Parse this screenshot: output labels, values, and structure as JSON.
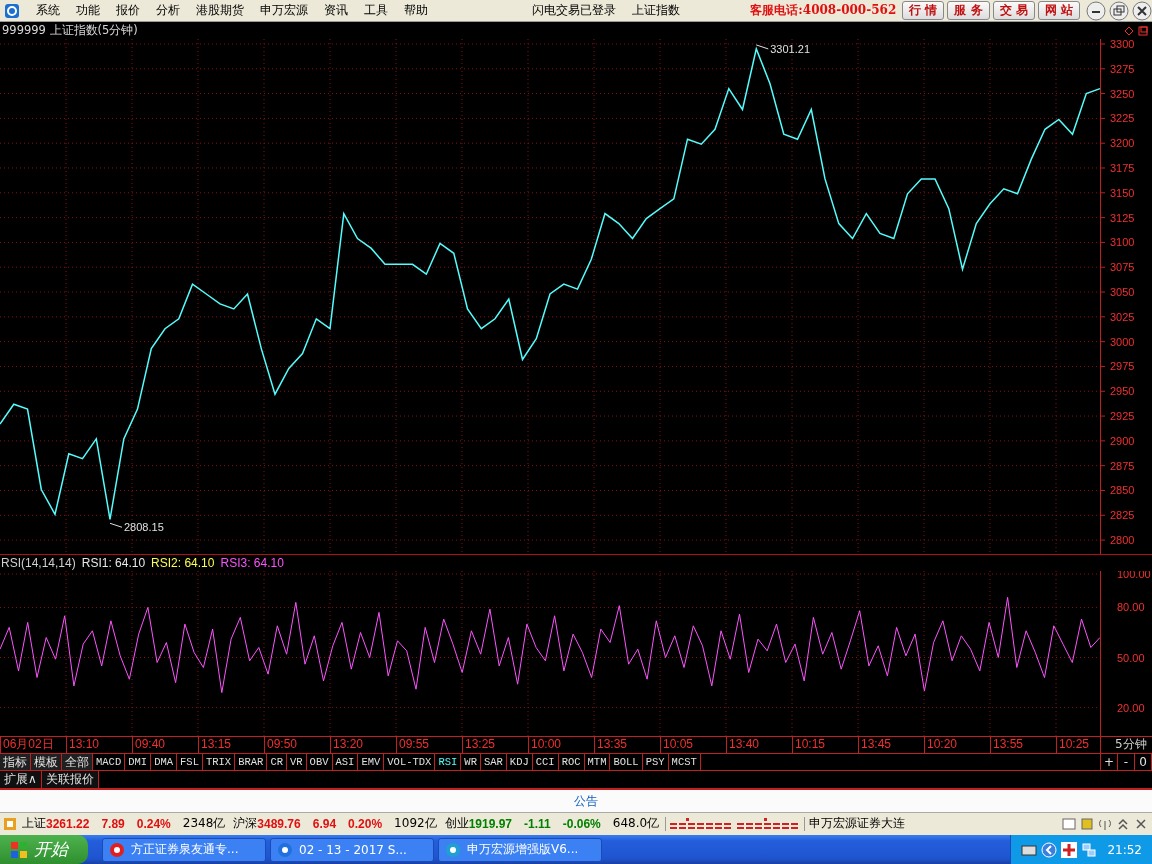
{
  "menu_bar": {
    "items": [
      "系统",
      "功能",
      "报价",
      "分析",
      "港股期货",
      "申万宏源",
      "资讯",
      "工具",
      "帮助"
    ],
    "status_texts": [
      "闪电交易已登录",
      "上证指数"
    ],
    "hotline": "客服电话:4008-000-562",
    "buttons": [
      "行 情",
      "服 务",
      "交 易",
      "网 站"
    ]
  },
  "main_chart": {
    "chart_data": {
      "type": "line",
      "title": "999999 上证指数(5分钟)",
      "ylim": [
        2786,
        3305
      ],
      "grid": true,
      "categories": [
        null,
        null,
        null,
        null,
        null,
        null,
        null,
        null,
        null,
        null,
        null,
        null,
        null,
        null,
        null,
        null,
        null,
        null,
        null,
        null,
        null,
        null,
        null,
        null,
        null,
        null,
        null,
        null,
        null,
        null,
        null,
        null,
        null,
        null,
        null,
        null,
        null,
        null,
        null,
        null,
        null,
        null,
        null,
        null,
        null,
        null,
        null,
        null,
        null,
        null,
        null,
        null,
        null,
        null,
        null,
        null,
        null,
        null,
        null,
        null,
        null,
        null,
        null,
        null,
        null,
        null,
        null,
        null,
        null,
        null,
        null,
        null,
        null,
        null,
        null,
        null,
        null,
        null,
        null,
        null,
        null
      ],
      "yticks": [
        2800,
        2825,
        2850,
        2875,
        2900,
        2925,
        2950,
        2975,
        3000,
        3025,
        3050,
        3075,
        3100,
        3125,
        3150,
        3175,
        3200,
        3225,
        3250,
        3275,
        3300
      ],
      "series": [
        {
          "color": "#54fcfc",
          "values": [
            2917,
            2937,
            2932,
            2851,
            2826,
            2887,
            2882,
            2902,
            2821,
            2902,
            2932,
            2993,
            3013,
            3023,
            3058,
            3048,
            3038,
            3033,
            3048,
            2993,
            2947,
            2973,
            2988,
            3023,
            3013,
            3129,
            3104,
            3094,
            3078,
            3078,
            3078,
            3068,
            3099,
            3089,
            3033,
            3013,
            3023,
            3043,
            2982,
            3003,
            3048,
            3058,
            3053,
            3083,
            3129,
            3119,
            3104,
            3124,
            3134,
            3144,
            3204,
            3199,
            3214,
            3255,
            3234,
            3295,
            3260,
            3209,
            3204,
            3234,
            3164,
            3119,
            3104,
            3129,
            3109,
            3104,
            3149,
            3164,
            3164,
            3134,
            3073,
            3119,
            3139,
            3154,
            3149,
            3184,
            3214,
            3224,
            3209,
            3250,
            3255
          ]
        }
      ],
      "annotations": [
        "3301.21",
        "2808.15"
      ]
    }
  },
  "indicator": {
    "name": "RSI(14,14,14)",
    "lines": [
      {
        "label": "RSI1: 64.10",
        "color": "#e8e8e8"
      },
      {
        "label": "RSI2: 64.10",
        "color": "#fcfc54"
      },
      {
        "label": "RSI3: 64.10",
        "color": "#fc54fc"
      }
    ],
    "chart_data": {
      "type": "line",
      "ylim": [
        3,
        101.8
      ],
      "grid": true,
      "yticks": [
        {
          "value": 100,
          "label": "100.00"
        },
        {
          "value": 80,
          "label": "80.00"
        },
        {
          "value": 50,
          "label": "50.00"
        },
        {
          "value": 20,
          "label": "20.00"
        }
      ],
      "categories": [
        null,
        null,
        null,
        null,
        null,
        null,
        null,
        null,
        null,
        null,
        null,
        null,
        null,
        null,
        null,
        null,
        null,
        null,
        null,
        null,
        null,
        null,
        null,
        null,
        null,
        null,
        null,
        null,
        null,
        null,
        null,
        null,
        null,
        null,
        null,
        null,
        null,
        null,
        null,
        null,
        null,
        null,
        null,
        null,
        null,
        null,
        null,
        null,
        null,
        null,
        null,
        null,
        null,
        null,
        null,
        null,
        null,
        null,
        null,
        null,
        null,
        null,
        null,
        null,
        null,
        null,
        null,
        null,
        null,
        null,
        null,
        null,
        null,
        null,
        null,
        null,
        null,
        null,
        null,
        null,
        null,
        null,
        null,
        null,
        null,
        null,
        null,
        null,
        null,
        null,
        null,
        null,
        null,
        null,
        null,
        null,
        null,
        null,
        null,
        null,
        null,
        null,
        null,
        null,
        null,
        null,
        null,
        null,
        null,
        null,
        null,
        null,
        null,
        null,
        null,
        null,
        null,
        null,
        null,
        null
      ],
      "series": [
        {
          "color": "#fc54fc",
          "values": [
            55,
            68,
            42,
            71,
            38,
            62,
            49,
            75,
            33,
            58,
            66,
            45,
            72,
            51,
            37,
            64,
            80,
            47,
            59,
            35,
            70,
            53,
            44,
            67,
            29,
            61,
            74,
            48,
            56,
            40,
            69,
            52,
            83,
            46,
            63,
            36,
            57,
            71,
            43,
            65,
            50,
            77,
            39,
            60,
            54,
            31,
            68,
            47,
            73,
            58,
            41,
            66,
            52,
            79,
            45,
            62,
            34,
            70,
            56,
            48,
            75,
            42,
            64,
            53,
            38,
            67,
            59,
            81,
            46,
            55,
            37,
            72,
            50,
            63,
            44,
            69,
            57,
            33,
            66,
            49,
            76,
            41,
            61,
            54,
            70,
            47,
            58,
            36,
            74,
            52,
            65,
            43,
            60,
            78,
            45,
            57,
            39,
            68,
            51,
            64,
            30,
            59,
            72,
            48,
            63,
            55,
            42,
            71,
            50,
            86,
            44,
            66,
            53,
            38,
            69,
            58,
            47,
            73,
            56,
            62
          ]
        }
      ]
    }
  },
  "time_axis": [
    "06月02日",
    "13:10",
    "09:40",
    "13:15",
    "09:50",
    "13:20",
    "09:55",
    "13:25",
    "10:00",
    "13:35",
    "10:05",
    "13:40",
    "10:15",
    "13:45",
    "10:20",
    "13:55",
    "10:25"
  ],
  "period": "5分钟",
  "indicator_tabs": [
    {
      "label": "指标",
      "selected": false
    },
    {
      "label": "模板",
      "selected": false
    },
    {
      "label": "全部",
      "selected": false
    },
    {
      "label": "MACD",
      "selected": false
    },
    {
      "label": "DMI",
      "selected": false
    },
    {
      "label": "DMA",
      "selected": false
    },
    {
      "label": "FSL",
      "selected": false
    },
    {
      "label": "TRIX",
      "selected": false
    },
    {
      "label": "BRAR",
      "selected": false
    },
    {
      "label": "CR",
      "selected": false
    },
    {
      "label": "VR",
      "selected": false
    },
    {
      "label": "OBV",
      "selected": false
    },
    {
      "label": "ASI",
      "selected": false
    },
    {
      "label": "EMV",
      "selected": false
    },
    {
      "label": "VOL-TDX",
      "selected": false
    },
    {
      "label": "RSI",
      "selected": true
    },
    {
      "label": "WR",
      "selected": false
    },
    {
      "label": "SAR",
      "selected": false
    },
    {
      "label": "KDJ",
      "selected": false
    },
    {
      "label": "CCI",
      "selected": false
    },
    {
      "label": "ROC",
      "selected": false
    },
    {
      "label": "MTM",
      "selected": false
    },
    {
      "label": "BOLL",
      "selected": false
    },
    {
      "label": "PSY",
      "selected": false
    },
    {
      "label": "MCST",
      "selected": false
    }
  ],
  "zoom_buttons": [
    "+",
    "-",
    "0"
  ],
  "extra_tabs": [
    "扩展∧",
    "关联报价"
  ],
  "notice": "公告",
  "status_bar": {
    "quotes": [
      {
        "name": "上证",
        "price": "3261.22",
        "change": "7.89",
        "percent": "0.24%",
        "volume": "2348亿",
        "color": "#e01010"
      },
      {
        "name": "沪深",
        "price": "3489.76",
        "change": "6.94",
        "percent": "0.20%",
        "volume": "1092亿",
        "color": "#e01010"
      },
      {
        "name": "创业",
        "price": "1919.97",
        "change": "-1.11",
        "percent": "-0.06%",
        "volume": "648.0亿",
        "color": "#008000"
      }
    ],
    "broker": "申万宏源证券大连"
  },
  "taskbar": {
    "start": "开始",
    "tasks": [
      "方正证券泉友通专...",
      "02 - 13 - 2017 S...",
      "申万宏源增强版V6..."
    ],
    "clock": "21:52"
  }
}
